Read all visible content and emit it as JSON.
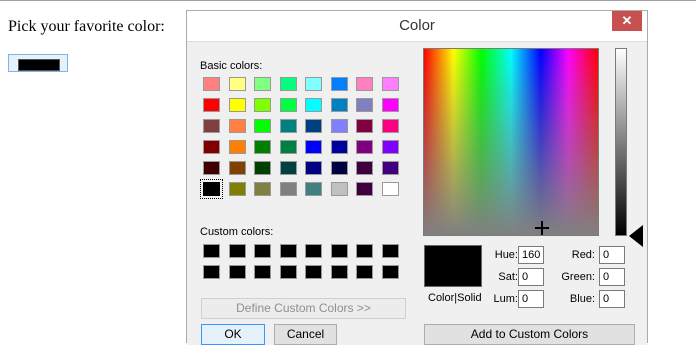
{
  "page": {
    "prompt": "Pick your favorite color:",
    "selected_color_hex": "#000000"
  },
  "dialog": {
    "title": "Color",
    "close_glyph": "✕",
    "basic_colors_label": "Basic colors:",
    "custom_colors_label": "Custom colors:",
    "basic_colors": [
      [
        "#ff8080",
        "#ffff80",
        "#80ff80",
        "#00ff80",
        "#80ffff",
        "#0080ff",
        "#ff80c0",
        "#ff80ff"
      ],
      [
        "#ff0000",
        "#ffff00",
        "#80ff00",
        "#00ff40",
        "#00ffff",
        "#0080c0",
        "#8080c0",
        "#ff00ff"
      ],
      [
        "#804040",
        "#ff8040",
        "#00ff00",
        "#008080",
        "#004080",
        "#8080ff",
        "#800040",
        "#ff0080"
      ],
      [
        "#800000",
        "#ff8000",
        "#008000",
        "#008040",
        "#0000ff",
        "#0000a0",
        "#800080",
        "#8000ff"
      ],
      [
        "#400000",
        "#804000",
        "#004000",
        "#004040",
        "#000080",
        "#000040",
        "#400040",
        "#400080"
      ],
      [
        "#000000",
        "#808000",
        "#808040",
        "#808080",
        "#408080",
        "#c0c0c0",
        "#400040",
        "#ffffff"
      ]
    ],
    "selected_basic": "#000000",
    "custom_colors": [
      [
        "#000000",
        "#000000",
        "#000000",
        "#000000",
        "#000000",
        "#000000",
        "#000000",
        "#000000"
      ],
      [
        "#000000",
        "#000000",
        "#000000",
        "#000000",
        "#000000",
        "#000000",
        "#000000",
        "#000000"
      ]
    ],
    "define_custom_button": "Define Custom Colors >>",
    "ok_button": "OK",
    "cancel_button": "Cancel",
    "preview_label": "Color|Solid",
    "fields": {
      "hue_label": "Hue:",
      "hue": "160",
      "sat_label": "Sat:",
      "sat": "0",
      "lum_label": "Lum:",
      "lum": "0",
      "red_label": "Red:",
      "red": "0",
      "green_label": "Green:",
      "green": "0",
      "blue_label": "Blue:",
      "blue": "0"
    },
    "add_custom_button": "Add to Custom Colors"
  }
}
